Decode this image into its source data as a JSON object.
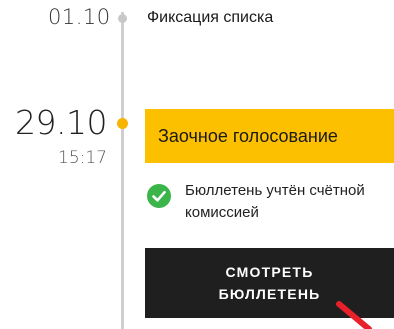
{
  "timeline": {
    "events": [
      {
        "date": "01.10",
        "title": "Фиксация списка"
      },
      {
        "date": "29.10",
        "time": "15:17",
        "stage": "Заочное голосование",
        "status": "Бюллетень учтён счётной комиссией",
        "button_label": "СМОТРЕТЬ БЮЛЛЕТЕНЬ"
      }
    ]
  },
  "colors": {
    "accent": "#fdc000",
    "dot_active": "#f7b500",
    "dot_inactive": "#c8c8c8",
    "line": "#cfcfcf",
    "success": "#3bb54a",
    "button_bg": "#1f1f1f",
    "arrow": "#e8202a"
  },
  "icons": {
    "status": "check-circle-icon",
    "pointer": "red-arrow-annotation"
  }
}
